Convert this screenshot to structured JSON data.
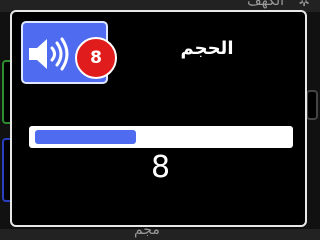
{
  "background": {
    "top_title": "الكهف",
    "bottom_label": "مجم"
  },
  "dialog": {
    "title": "الحجم",
    "badge_value": "8",
    "value_text": "8",
    "volume_level_fraction": 0.4,
    "icons": {
      "volume": "speaker-icon"
    },
    "colors": {
      "accent": "#4f6cf0",
      "badge": "#e01c1c",
      "border": "#e8e8e8"
    }
  }
}
